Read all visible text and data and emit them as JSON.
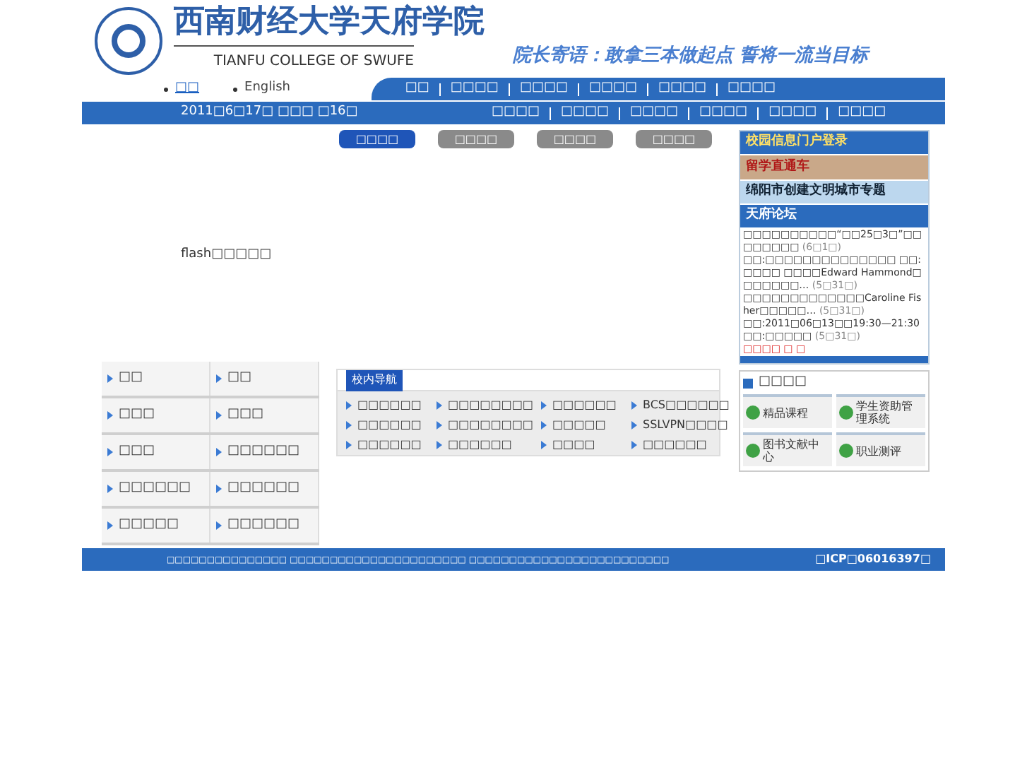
{
  "header": {
    "title": "西南财经大学天府学院",
    "subtitle": "TIANFU COLLEGE OF SWUFE",
    "motto": "院长寄语：敢拿三本做起点 誓将一流当目标"
  },
  "languages": [
    {
      "label": "□□",
      "selected": true
    },
    {
      "label": "English",
      "selected": false
    }
  ],
  "main_nav": [
    "□□",
    "□□□□",
    "□□□□",
    "□□□□",
    "□□□□",
    "□□□□"
  ],
  "date": "2011□6□17□ □□□ □16□",
  "sub_nav": [
    "□□□□",
    "□□□□",
    "□□□□",
    "□□□□",
    "□□□□",
    "□□□□"
  ],
  "tabs": [
    {
      "label": "□□□□",
      "selected": true
    },
    {
      "label": "□□□□",
      "selected": false
    },
    {
      "label": "□□□□",
      "selected": false
    },
    {
      "label": "□□□□",
      "selected": false
    }
  ],
  "flash_message": "flash□□□□□",
  "left_links": [
    "□□",
    "□□",
    "□□□",
    "□□□",
    "□□□",
    "□□□□□□",
    "□□□□□□",
    "□□□□□□",
    "□□□□□",
    "□□□□□□"
  ],
  "campus_nav": {
    "title": "校内导航",
    "links": [
      "□□□□□□",
      "□□□□□□□□",
      "□□□□□□",
      "BCS□□□□□□",
      "□□□□□□",
      "□□□□□□□□",
      "□□□□□",
      "SSLVPN□□□□",
      "□□□□□□",
      "□□□□□□",
      "□□□□",
      "□□□□□□"
    ]
  },
  "banners": [
    "校园信息门户登录",
    "留学直通车",
    "绵阳市创建文明城市专题",
    "天府论坛"
  ],
  "news": [
    {
      "title": "□□□□□□□□□□“□□25□3□”□□□□□□□□",
      "date": "(6□1□)"
    },
    {
      "title": "□□:□□□□□□□□□□□□□□ □□:□□□□ □□□□Edward Hammond□□□□□□□…",
      "date": "(5□31□)"
    },
    {
      "title": "□□□□□□□□□□□□□Caroline Fisher□□□□□…",
      "date": "(5□31□)"
    },
    {
      "title": "□□:2011□06□13□□19:30—21:30 □□:□□□□□",
      "date": "(5□31□)"
    }
  ],
  "news_more": "□□□□ □ □",
  "services": {
    "title": "□□□□",
    "items": [
      "精品课程",
      "学生资助管理系统",
      "图书文献中心",
      "职业测评"
    ]
  },
  "footer": {
    "text": "□□□□□□□□□□□□□□□ □□□□□□□□□□□□□□□□□□□□□□ □□□□□□□□□□□□□□□□□□□□□□□□□",
    "icp": "□ICP□06016397□"
  }
}
